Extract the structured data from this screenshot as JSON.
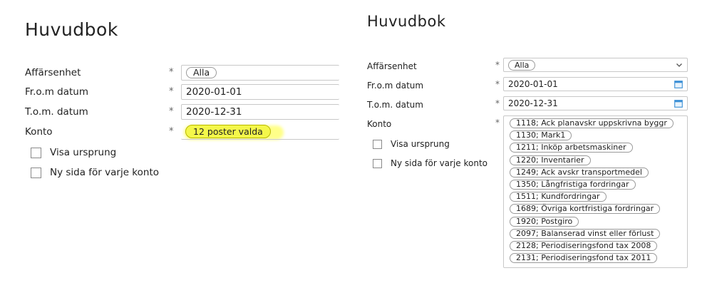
{
  "left": {
    "title": "Huvudbok",
    "fields": {
      "affarsenhet": {
        "label": "Affärsenhet",
        "value": "Alla"
      },
      "from_date": {
        "label": "Fr.o.m datum",
        "value": "2020-01-01"
      },
      "to_date": {
        "label": "T.o.m. datum",
        "value": "2020-12-31"
      },
      "konto": {
        "label": "Konto",
        "value": "12 poster valda"
      }
    },
    "checkboxes": {
      "visa_ursprung": "Visa ursprung",
      "ny_sida": "Ny sida för varje konto"
    }
  },
  "right": {
    "title": "Huvudbok",
    "fields": {
      "affarsenhet": {
        "label": "Affärsenhet",
        "value": "Alla"
      },
      "from_date": {
        "label": "Fr.o.m datum",
        "value": "2020-01-01"
      },
      "to_date": {
        "label": "T.o.m. datum",
        "value": "2020-12-31"
      },
      "konto": {
        "label": "Konto"
      }
    },
    "checkboxes": {
      "visa_ursprung": "Visa ursprung",
      "ny_sida": "Ny sida för varje konto"
    },
    "konto_items": [
      "1118; Ack planavskr uppskrivna byggr",
      "1130; Mark1",
      "1211; Inköp arbetsmaskiner",
      "1220; Inventarier",
      "1249; Ack avskr transportmedel",
      "1350; Långfristiga fordringar",
      "1511; Kundfordringar",
      "1689; Övriga kortfristiga fordringar",
      "1920; Postgiro",
      "2097; Balanserad vinst eller förlust",
      "2128; Periodiseringsfond tax 2008",
      "2131; Periodiseringsfond tax 2011"
    ]
  },
  "required_mark": "*",
  "colors": {
    "highlight": "#f4f74a",
    "calendar_icon": "#3a8fd6"
  },
  "icons": {
    "dropdown": "chevron-down-icon",
    "date": "calendar-icon"
  }
}
